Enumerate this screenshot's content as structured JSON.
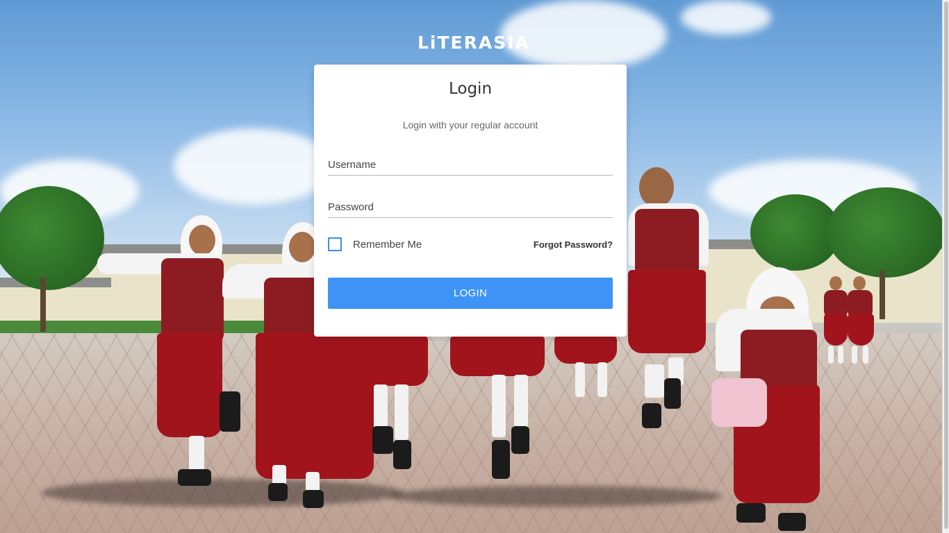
{
  "brand": {
    "logo_text": "LiTERASIA"
  },
  "login_card": {
    "title": "Login",
    "subtitle": "Login with your regular account",
    "username_placeholder": "Username",
    "username_value": "",
    "password_placeholder": "Password",
    "password_value": "",
    "remember_label": "Remember Me",
    "remember_checked": false,
    "forgot_label": "Forgot Password?",
    "submit_label": "LOGIN"
  },
  "colors": {
    "accent": "#3e94f6",
    "checkbox_border": "#3b8ee6",
    "card_background": "#ffffff"
  },
  "icons": [
    "checkbox"
  ]
}
